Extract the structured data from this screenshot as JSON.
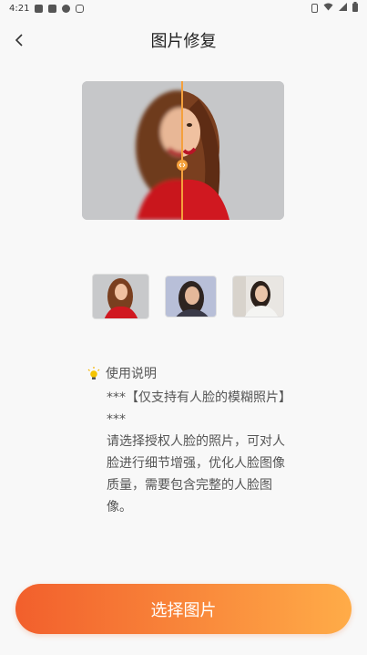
{
  "status_bar": {
    "time": "4:21",
    "left_icons": [
      "gallery-icon",
      "a-icon",
      "chat-icon",
      "bug-icon"
    ],
    "right_icons": [
      "vibrate-icon",
      "wifi-icon",
      "signal-icon",
      "battery-icon"
    ]
  },
  "header": {
    "back_icon": "chevron-left-icon",
    "title": "图片修复"
  },
  "preview": {
    "divider_icon": "compare-handle-icon"
  },
  "thumbnails": [
    {
      "name": "sample-woman-red",
      "selected": true
    },
    {
      "name": "sample-woman-dark-hair",
      "selected": false
    },
    {
      "name": "sample-woman-white-shirt",
      "selected": false
    }
  ],
  "instructions": {
    "icon": "lightbulb-icon",
    "title": "使用说明",
    "line1": "***【仅支持有人脸的模糊照片】***",
    "line2": "请选择授权人脸的照片，可对人脸进行细节增强，优化人脸图像质量，需要包含完整的人脸图像。"
  },
  "actions": {
    "select_label": "选择图片"
  },
  "colors": {
    "accent_start": "#f25f2c",
    "accent_end": "#ffac48",
    "divider": "#f5a03c"
  }
}
